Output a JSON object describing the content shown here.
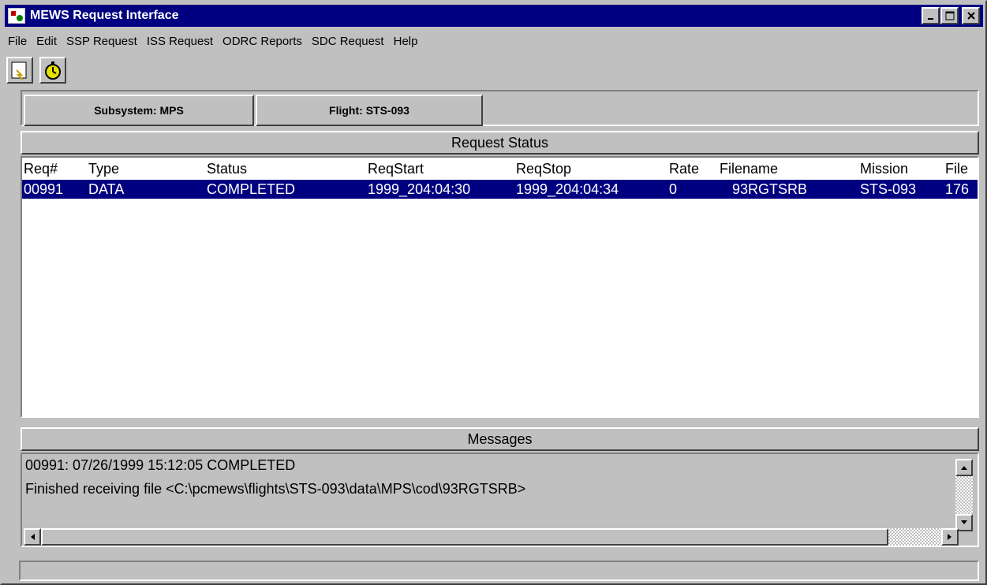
{
  "window": {
    "title": "MEWS Request Interface"
  },
  "menu": [
    "File",
    "Edit",
    "SSP Request",
    "ISS Request",
    "ODRC Reports",
    "SDC Request",
    "Help"
  ],
  "toolbar": {
    "tools": [
      "exit-icon",
      "stopwatch-icon"
    ]
  },
  "buttons": {
    "subsystem": "Subsystem: MPS",
    "flight": "Flight: STS-093"
  },
  "request_status": {
    "title": "Request Status",
    "columns": [
      "Req#",
      "Type",
      "Status",
      "ReqStart",
      "ReqStop",
      "Rate",
      "Filename",
      "Mission",
      "File"
    ],
    "rows": [
      [
        "00991",
        "DATA",
        "COMPLETED",
        "1999_204:04:30",
        "1999_204:04:34",
        "0",
        "93RGTSRB",
        "STS-093",
        "176"
      ]
    ]
  },
  "messages": {
    "title": "Messages",
    "lines": [
      "00991: 07/26/1999 15:12:05 COMPLETED",
      "Finished receiving file <C:\\pcmews\\flights\\STS-093\\data\\MPS\\cod\\93RGTSRB>"
    ]
  },
  "status_bar": {
    "text": ""
  },
  "colors": {
    "titlebar": "#000080",
    "selection": "#000080",
    "face": "#c0c0c0"
  }
}
